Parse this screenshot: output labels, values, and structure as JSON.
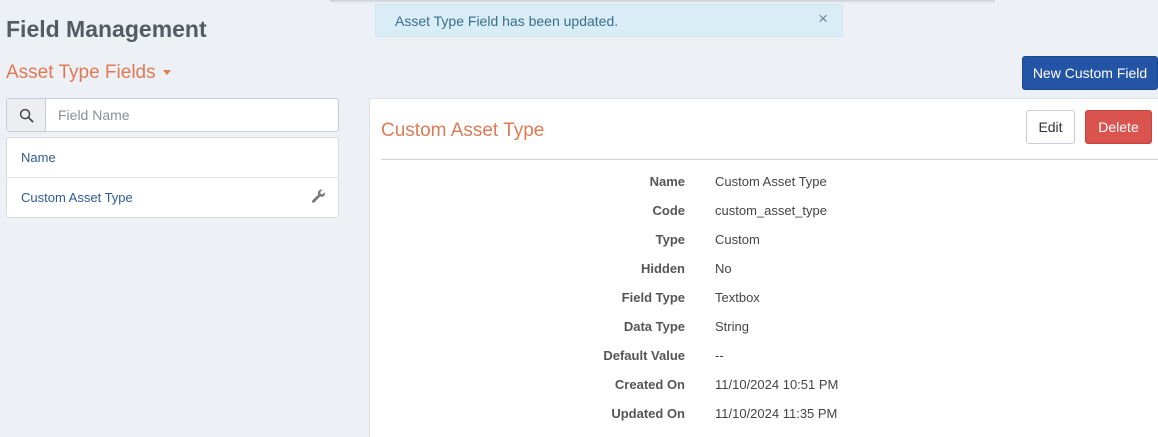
{
  "header": {
    "title": "Field Management"
  },
  "alert": {
    "message": "Asset Type Field has been updated.",
    "close_icon": "×"
  },
  "section": {
    "title": "Asset Type Fields"
  },
  "toolbar": {
    "new_button": "New Custom Field"
  },
  "search": {
    "placeholder": "Field Name",
    "value": ""
  },
  "field_list": {
    "items": [
      {
        "label": "Name",
        "has_settings": false
      },
      {
        "label": "Custom Asset Type",
        "has_settings": true
      }
    ]
  },
  "detail": {
    "title": "Custom Asset Type",
    "edit_button": "Edit",
    "delete_button": "Delete",
    "rows": [
      {
        "label": "Name",
        "value": "Custom Asset Type"
      },
      {
        "label": "Code",
        "value": "custom_asset_type"
      },
      {
        "label": "Type",
        "value": "Custom"
      },
      {
        "label": "Hidden",
        "value": "No"
      },
      {
        "label": "Field Type",
        "value": "Textbox"
      },
      {
        "label": "Data Type",
        "value": "String"
      },
      {
        "label": "Default Value",
        "value": "--"
      },
      {
        "label": "Created On",
        "value": "11/10/2024 10:51 PM"
      },
      {
        "label": "Updated On",
        "value": "11/10/2024 11:35 PM"
      }
    ]
  },
  "colors": {
    "accent_orange": "#e07a56",
    "primary_blue": "#2454a6",
    "danger_red": "#d9534f",
    "alert_bg": "#d9edf7",
    "link_blue": "#2e5c97"
  },
  "icons": {
    "search": "search-icon",
    "settings": "wrench-icon",
    "close": "close-icon",
    "dropdown": "caret-down-icon"
  }
}
